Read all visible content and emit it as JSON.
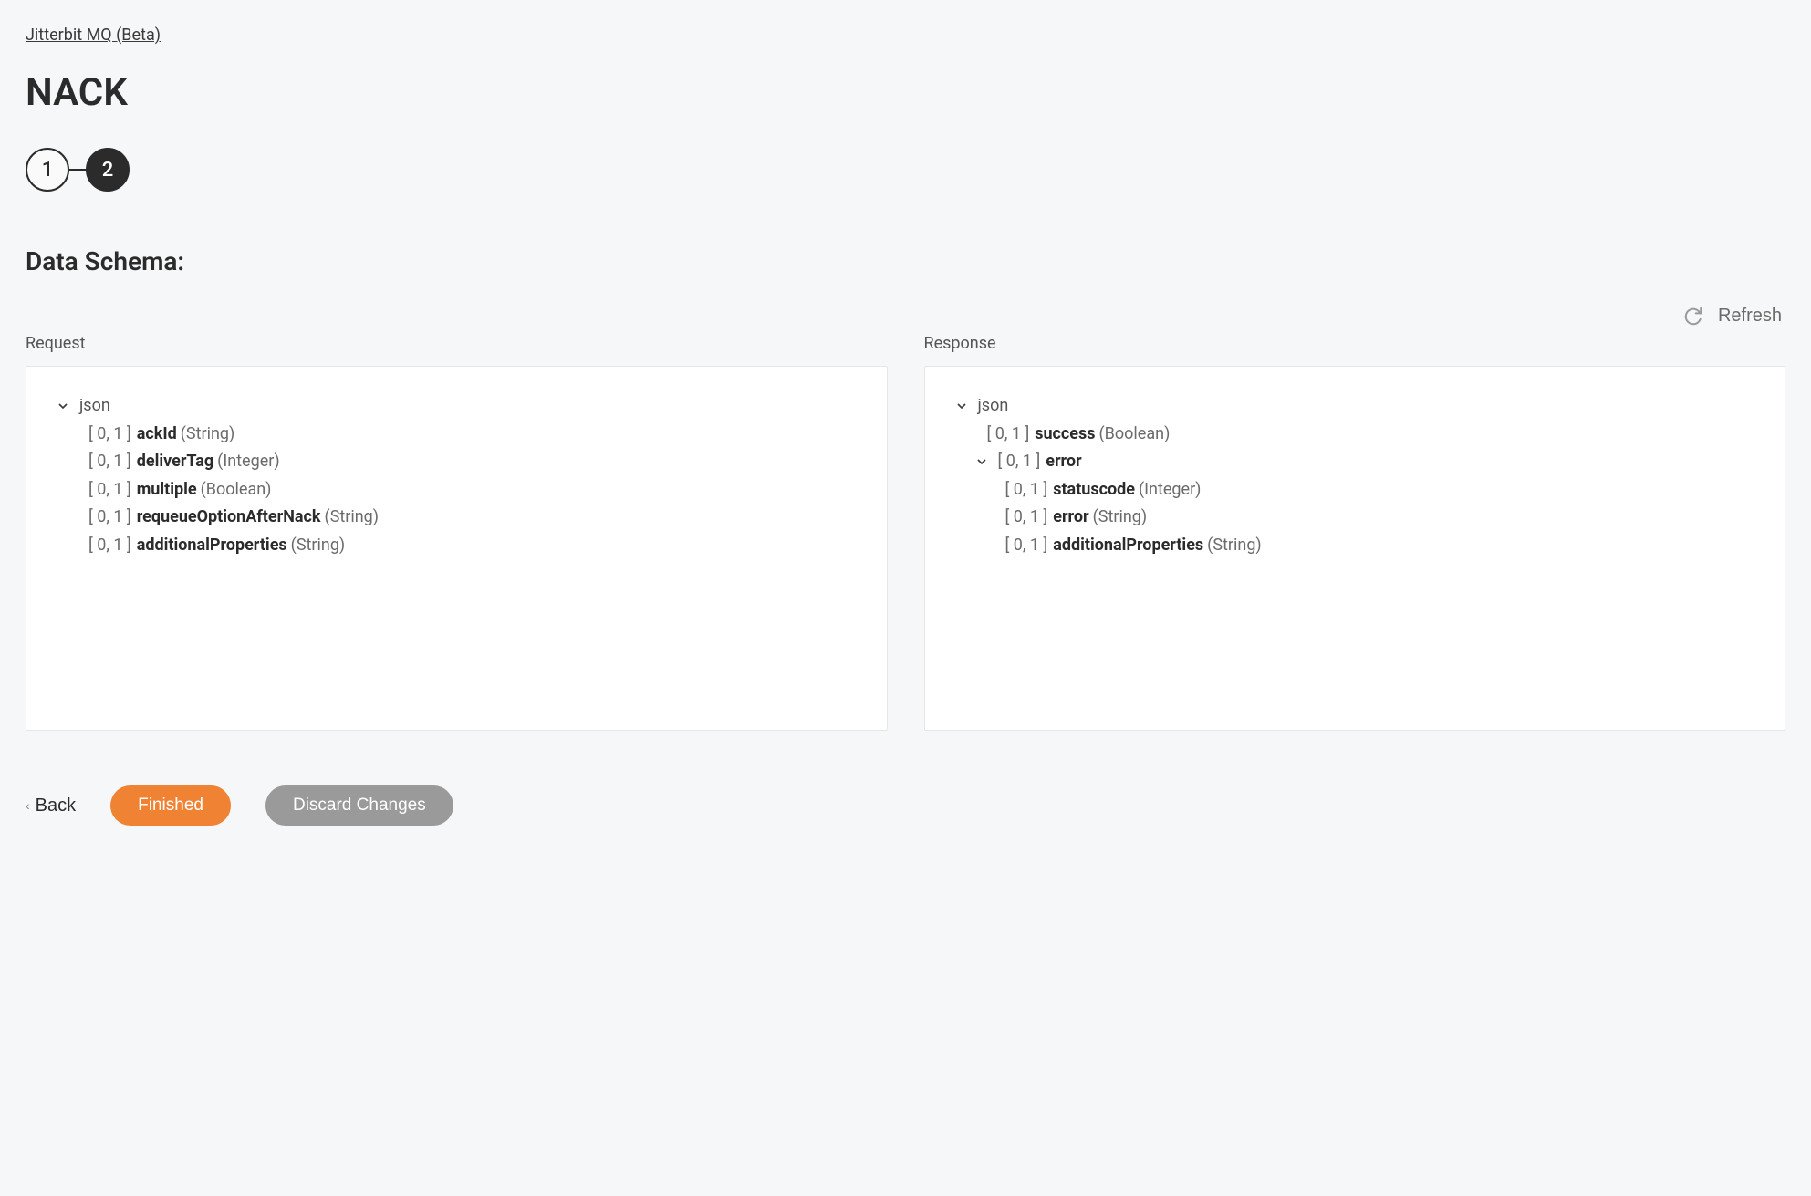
{
  "breadcrumb": "Jitterbit MQ (Beta)",
  "title": "NACK",
  "steps": {
    "step1": "1",
    "step2": "2"
  },
  "section_title": "Data Schema:",
  "refresh_label": "Refresh",
  "request_label": "Request",
  "response_label": "Response",
  "request_root": "json",
  "response_root": "json",
  "request_fields": [
    {
      "card": "[ 0, 1 ]",
      "name": "ackId",
      "type": "(String)"
    },
    {
      "card": "[ 0, 1 ]",
      "name": "deliverTag",
      "type": "(Integer)"
    },
    {
      "card": "[ 0, 1 ]",
      "name": "multiple",
      "type": "(Boolean)"
    },
    {
      "card": "[ 0, 1 ]",
      "name": "requeueOptionAfterNack",
      "type": "(String)"
    },
    {
      "card": "[ 0, 1 ]",
      "name": "additionalProperties",
      "type": "(String)"
    }
  ],
  "response_fields": [
    {
      "card": "[ 0, 1 ]",
      "name": "success",
      "type": "(Boolean)"
    }
  ],
  "response_error": {
    "card": "[ 0, 1 ]",
    "name": "error"
  },
  "response_error_children": [
    {
      "card": "[ 0, 1 ]",
      "name": "statuscode",
      "type": "(Integer)"
    },
    {
      "card": "[ 0, 1 ]",
      "name": "error",
      "type": "(String)"
    },
    {
      "card": "[ 0, 1 ]",
      "name": "additionalProperties",
      "type": "(String)"
    }
  ],
  "buttons": {
    "back": "Back",
    "finished": "Finished",
    "discard": "Discard Changes"
  }
}
